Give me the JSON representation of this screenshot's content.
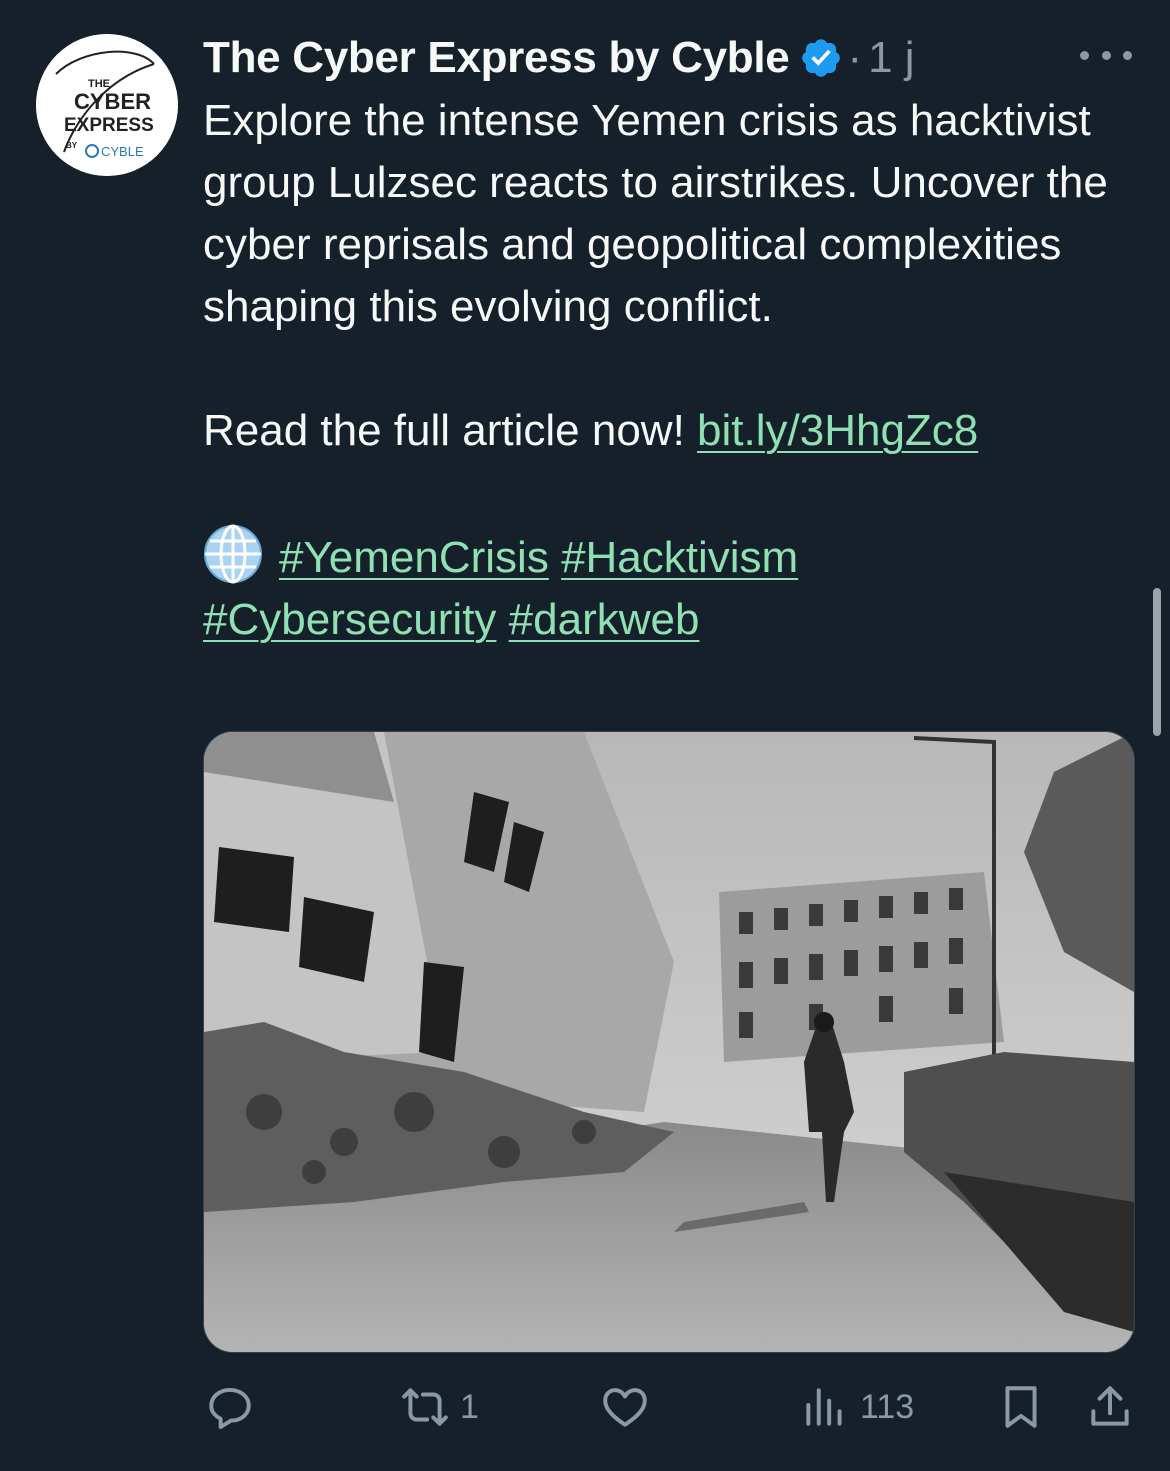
{
  "author": {
    "name": "The Cyber Express by Cyble",
    "verified_icon": "verified-badge-icon",
    "separator": "·",
    "time": "1 j",
    "avatar_logo_lines": [
      "THE",
      "CYBER",
      "EXPRESS",
      "BY",
      "CYBLE"
    ]
  },
  "tweet": {
    "body": "Explore the intense Yemen crisis as hacktivist group Lulzsec reacts to airstrikes. Uncover the cyber reprisals and geopolitical complexities shaping this evolving conflict.",
    "read_prefix": "Read the full article now! ",
    "link": "bit.ly/3HhgZc8",
    "globe_icon": "globe-emoji-icon",
    "hashtags": [
      "#YemenCrisis",
      "#Hacktivism",
      "#Cybersecurity",
      "#darkweb"
    ]
  },
  "media": {
    "type": "photo",
    "colors": "black and white"
  },
  "actions": {
    "reply": {
      "icon": "reply-icon",
      "count": ""
    },
    "retweet": {
      "icon": "retweet-icon",
      "count": "1"
    },
    "like": {
      "icon": "heart-icon",
      "count": ""
    },
    "views": {
      "icon": "views-chart-icon",
      "count": "113"
    },
    "bookmark": {
      "icon": "bookmark-icon"
    },
    "share": {
      "icon": "share-icon"
    }
  },
  "colors": {
    "background": "#15202b",
    "link": "#8fe0b2",
    "muted": "#8b98a5",
    "verified": "#1d9bf0"
  }
}
